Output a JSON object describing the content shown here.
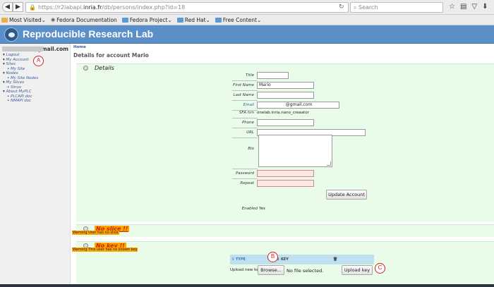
{
  "browser": {
    "url_prefix": "https://r2labapi.",
    "url_host": "inria.fr",
    "url_path": "/db/persons/index.php?id=18",
    "search_placeholder": "Search",
    "bookmarks": [
      {
        "label": "Most Visited",
        "icon": "folder-yellow"
      },
      {
        "label": "Fedora Documentation",
        "icon": "fedora-icon"
      },
      {
        "label": "Fedora Project",
        "icon": "folder"
      },
      {
        "label": "Red Hat",
        "icon": "folder"
      },
      {
        "label": "Free Content",
        "icon": "folder"
      }
    ]
  },
  "site": {
    "title": "Reproducible Research Lab"
  },
  "sidebar": {
    "account_domain": "@gmail.com",
    "menu": [
      {
        "label": "Logout",
        "level": 1
      },
      {
        "label": "My Account",
        "level": 1
      },
      {
        "label": "Sites",
        "level": 1
      },
      {
        "label": "My Site",
        "level": 2
      },
      {
        "label": "Nodes",
        "level": 1
      },
      {
        "label": "My Site Nodes",
        "level": 2
      },
      {
        "label": "My Slices",
        "level": 1
      },
      {
        "label": "Sinus",
        "level": 2
      },
      {
        "label": "About MyPLC",
        "level": 1
      },
      {
        "label": "PLCAPI doc",
        "level": 2
      },
      {
        "label": "NMAPI doc",
        "level": 2
      }
    ]
  },
  "markers": {
    "a": "A",
    "b": "B",
    "c": "C"
  },
  "main": {
    "breadcrumb": "Home",
    "page_title": "Details for account Mario",
    "details_heading": "Details",
    "fields": {
      "title_label": "Title",
      "title_value": "",
      "first_name_label": "First Name",
      "first_name_value": "Mario",
      "last_name_label": "Last Name",
      "last_name_value": "",
      "email_label": "Email",
      "email_value": "@gmail.com",
      "sfa_label": "SFA hrn",
      "sfa_value": "onelab.inria.nano_creaator",
      "phone_label": "Phone",
      "url_label": "URL",
      "bio_label": "Bio",
      "password_label": "Password",
      "repeat_label": "Repeat"
    },
    "update_button": "Update Account",
    "enabled_label": "Enabled",
    "enabled_value": "Yes",
    "slice_heading": "No slice !!",
    "slice_warning": "Warning User has no slice",
    "key_heading": "No key !!",
    "key_warning": "Warning This user has no known key",
    "keys_table": {
      "col_type": "TYPE",
      "col_key": "KEY",
      "col_delete_icon": "trash-icon"
    },
    "upload_label": "Upload new key",
    "browse_button": "Browse...",
    "no_file_text": "No file selected.",
    "upload_button": "Upload key"
  }
}
